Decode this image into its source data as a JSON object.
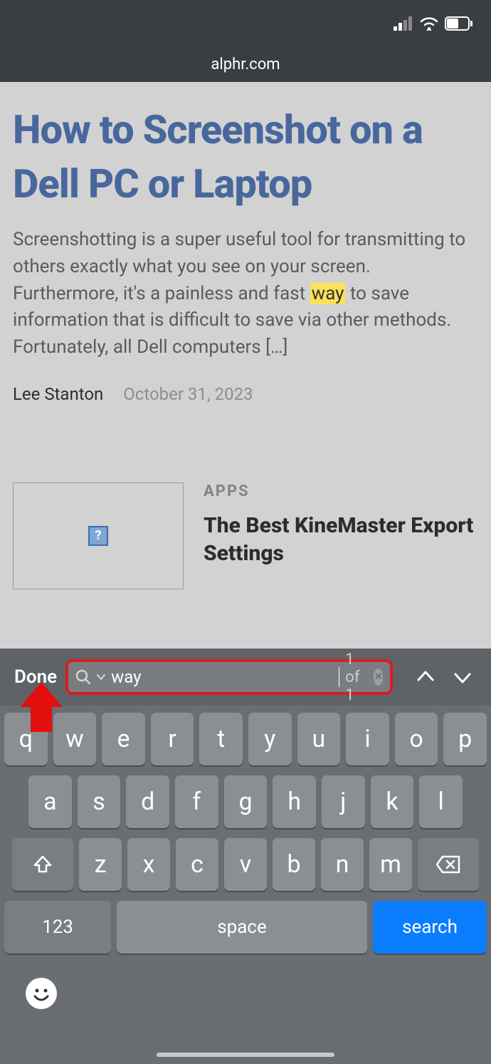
{
  "status": {
    "domain": "alphr.com"
  },
  "article": {
    "title": "How to Screenshot on a Dell PC or Laptop",
    "body_pre": "Screenshotting is a super useful tool for transmitting to others exactly what you see on your screen. Furthermore, it's a painless and fast ",
    "highlight": "way",
    "body_post": " to save information that is difficult to save via other methods. Fortunately, all Dell computers […]",
    "author": "Lee Stanton",
    "date": "October 31, 2023"
  },
  "related": {
    "category": "APPS",
    "title": "The Best KineMaster Export Settings",
    "thumb_placeholder": "?"
  },
  "find": {
    "done": "Done",
    "query": "way",
    "count": "1 of 1"
  },
  "keyboard": {
    "row1": [
      "q",
      "w",
      "e",
      "r",
      "t",
      "y",
      "u",
      "i",
      "o",
      "p"
    ],
    "row2": [
      "a",
      "s",
      "d",
      "f",
      "g",
      "h",
      "j",
      "k",
      "l"
    ],
    "row3": [
      "z",
      "x",
      "c",
      "v",
      "b",
      "n",
      "m"
    ],
    "num": "123",
    "space": "space",
    "search": "search"
  }
}
